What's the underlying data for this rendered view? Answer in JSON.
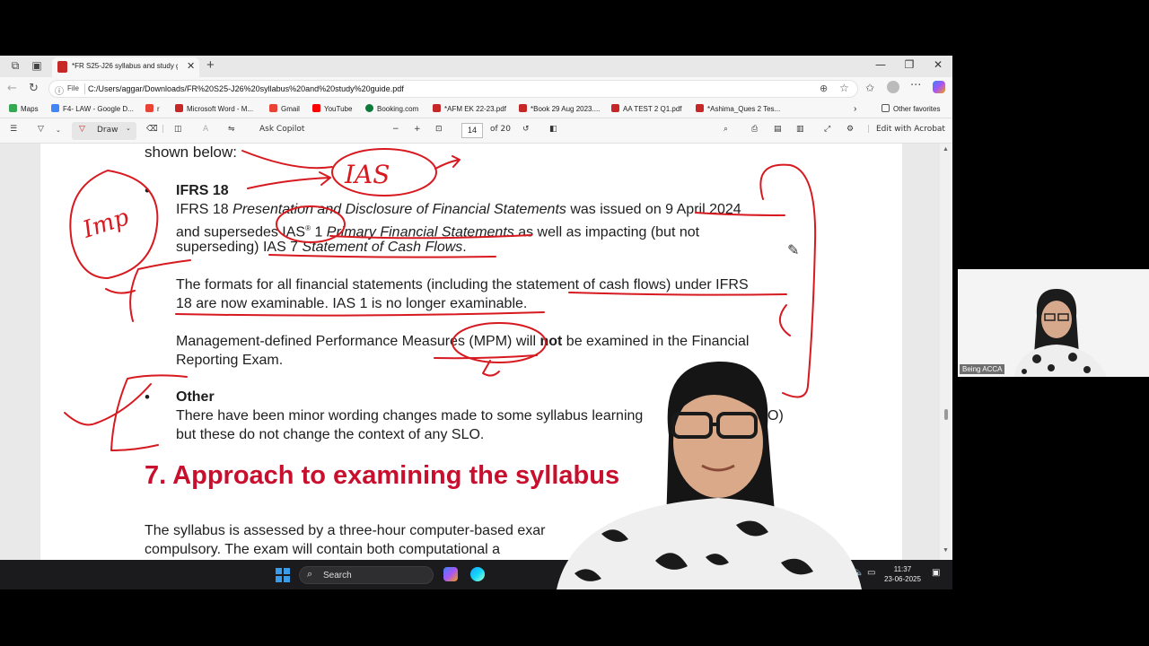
{
  "browser": {
    "tab_title": "*FR S25-J26 syllabus and study gu",
    "url_scheme": "File",
    "url": "C:/Users/aggar/Downloads/FR%20S25-J26%20syllabus%20and%20study%20guide.pdf"
  },
  "bookmarks": [
    {
      "label": "Maps",
      "color": "#34a853"
    },
    {
      "label": "F4- LAW - Google D...",
      "color": "#4285f4"
    },
    {
      "label": "r",
      "color": "#ea4335"
    },
    {
      "label": "Microsoft Word - M...",
      "color": "#c62828"
    },
    {
      "label": "Gmail",
      "color": "#ea4335"
    },
    {
      "label": "YouTube",
      "color": "#ff0000"
    },
    {
      "label": "Booking.com",
      "color": "#0b7a3a"
    },
    {
      "label": "*AFM EK 22-23.pdf",
      "color": "#c62828"
    },
    {
      "label": "*Book 29 Aug 2023....",
      "color": "#c62828"
    },
    {
      "label": "AA TEST 2 Q1.pdf",
      "color": "#c62828"
    },
    {
      "label": "*Ashima_Ques 2 Tes...",
      "color": "#c62828"
    }
  ],
  "other_favorites": "Other favorites",
  "pdf_toolbar": {
    "draw_label": "Draw",
    "ask_copilot": "Ask Copilot",
    "current_page": "14",
    "total_pages": "of 20",
    "edit_acrobat": "Edit with Acrobat"
  },
  "document": {
    "shown_below": "shown below:",
    "ifrs_title": "IFRS 18",
    "ifrs_l1a": "IFRS 18 ",
    "ifrs_l1b": "Presentation and Disclosure of Financial Statements",
    "ifrs_l1c": " was issued on 9 April 2024",
    "ifrs_l2a": "and supersedes IAS",
    "ifrs_l2sup": "®",
    "ifrs_l2b": " 1 ",
    "ifrs_l2c": "Primary Financial Statements",
    "ifrs_l2d": " as well as impacting (but not",
    "ifrs_l3a": "superseding) IAS 7 ",
    "ifrs_l3b": "Statement of Cash Flows",
    "ifrs_l3c": ".",
    "formats_l1": "The formats for all financial statements (including the statement of cash flows) under IFRS",
    "formats_l2": "18 are now examinable. IAS 1 is no longer examinable.",
    "mpm_l1a": "Management-defined Performance Measures (MPM) will ",
    "mpm_l1b": "not",
    "mpm_l1c": " be examined in the Financial",
    "mpm_l2": "Reporting Exam.",
    "other_title": "Other",
    "other_l1": "There have been minor wording changes made to some syllabus learning",
    "other_l1_tail": "O)",
    "other_l2": "but these do not change the context of any SLO.",
    "section_heading": "7. Approach to examining the syllabus",
    "approach_l1": "The syllabus is assessed by a three-hour computer-based exar",
    "approach_l2": "compulsory. The exam will contain both computational a"
  },
  "annotations": {
    "ias_note": "IAS",
    "imp_note": "Imp"
  },
  "taskbar": {
    "search_label": "Search",
    "time": "11:37",
    "date": "23-06-2025"
  },
  "webcam": {
    "small_label": "Being ACCA"
  }
}
